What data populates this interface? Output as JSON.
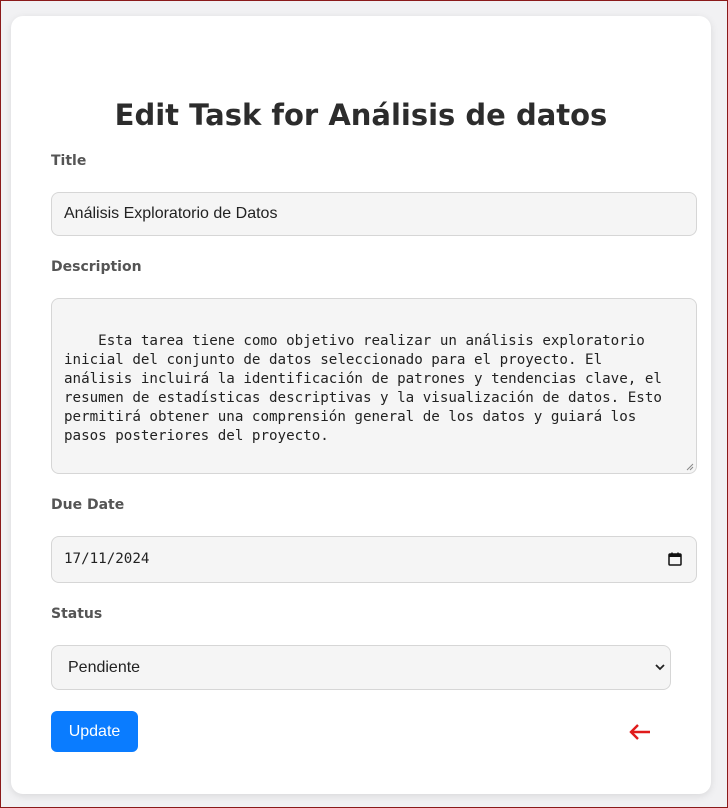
{
  "page": {
    "title": "Edit Task for Análisis de datos"
  },
  "form": {
    "title_label": "Title",
    "title_value": "Análisis Exploratorio de Datos",
    "description_label": "Description",
    "description_value": "Esta tarea tiene como objetivo realizar un análisis exploratorio\ninicial del conjunto de datos seleccionado para el proyecto. El\nanálisis incluirá la identificación de patrones y tendencias clave, el\nresumen de estadísticas descriptivas y la visualización de datos. Esto\npermitirá obtener una comprensión general de los datos y guiará los\npasos posteriores del proyecto.",
    "due_date_label": "Due Date",
    "due_date_value": "17/11/2024",
    "status_label": "Status",
    "status_value": "Pendiente",
    "update_label": "Update"
  },
  "icons": {
    "calendar": "calendar-icon",
    "select_chevron": "chevron-down-icon",
    "back": "arrow-left-icon"
  },
  "colors": {
    "primary_button": "#0a7cff",
    "back_arrow": "#e01b1b"
  }
}
